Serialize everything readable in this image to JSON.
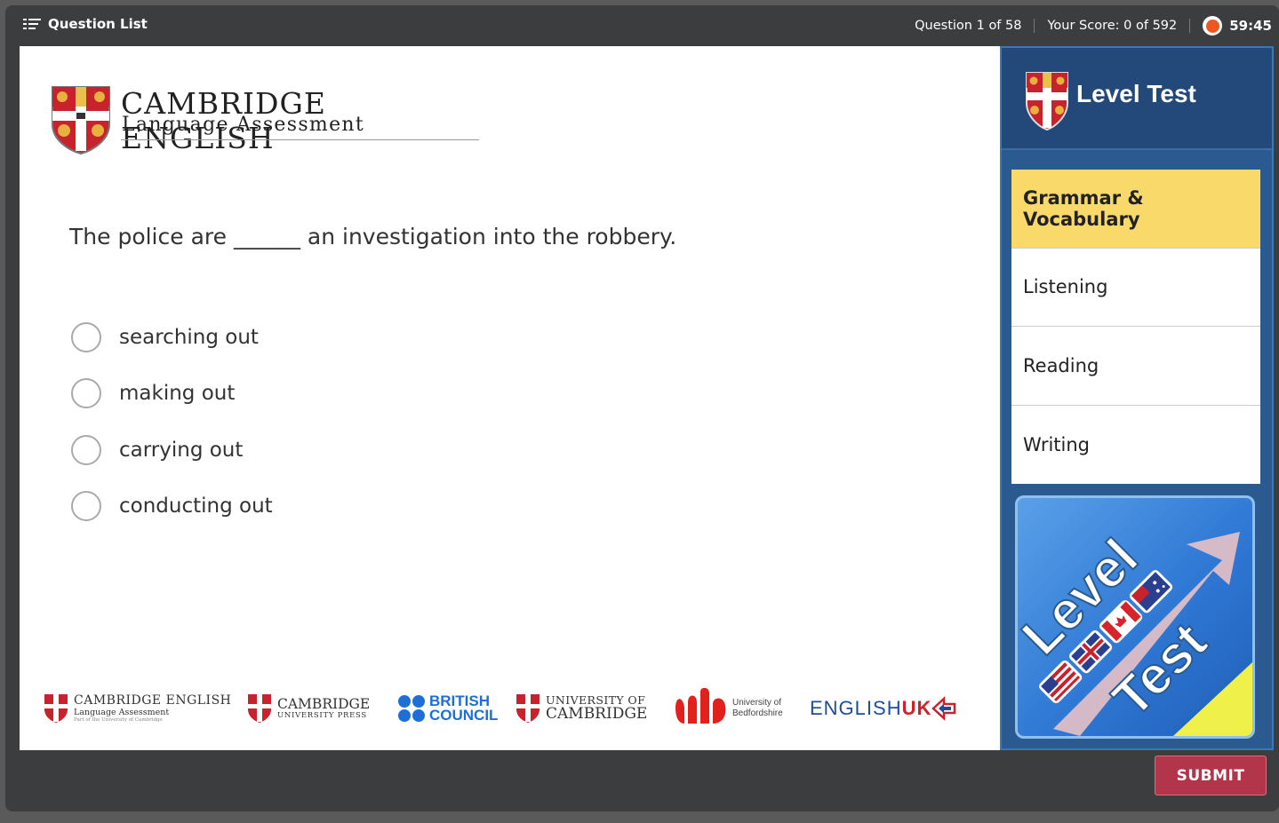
{
  "topbar": {
    "question_list_label": "Question List",
    "question_counter": "Question 1 of 58",
    "score": "Your Score: 0 of 592",
    "timer": "59:45"
  },
  "brand": {
    "name": "CAMBRIDGE ENGLISH",
    "subtitle": "Language Assessment"
  },
  "question": {
    "text": "The police are ______ an investigation into the robbery.",
    "options": [
      "searching out",
      "making out",
      "carrying out",
      "conducting out"
    ]
  },
  "logos": {
    "cambridge_english": {
      "line1": "CAMBRIDGE ENGLISH",
      "line2": "Language Assessment",
      "line3": "Part of the University of Cambridge"
    },
    "cambridge_press": {
      "line1": "CAMBRIDGE",
      "line2": "UNIVERSITY PRESS"
    },
    "british_council": {
      "line1": "BRITISH",
      "line2": "COUNCIL"
    },
    "university_cambridge": {
      "line1": "UNIVERSITY OF",
      "line2": "CAMBRIDGE"
    },
    "bedfordshire": {
      "line1": "University of",
      "line2": "Bedfordshire"
    },
    "english_uk": {
      "part1": "ENGLISH",
      "part2": "UK"
    }
  },
  "sidebar": {
    "title": "Level Test",
    "sections": [
      {
        "label": "Grammar & Vocabulary",
        "active": true
      },
      {
        "label": "Listening",
        "active": false
      },
      {
        "label": "Reading",
        "active": false
      },
      {
        "label": "Writing",
        "active": false
      }
    ],
    "promo": {
      "word1": "Level",
      "word2": "Test"
    }
  },
  "actions": {
    "submit_label": "SUBMIT"
  },
  "colors": {
    "accent_yellow": "#fad96b",
    "sidebar_blue": "#2a5a8f",
    "submit_red": "#b3354a",
    "timer_orange": "#f0571f"
  }
}
